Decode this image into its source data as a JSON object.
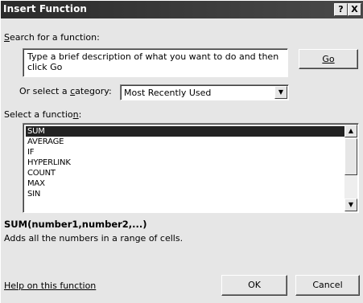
{
  "dialog": {
    "title": "Insert Function",
    "help_button": "?",
    "close_button": "X"
  },
  "search": {
    "label": "Search for a function:",
    "value": "Type a brief description of what you want to do and then click Go",
    "go_button": "Go"
  },
  "category": {
    "label": "Or select a category:",
    "selected": "Most Recently Used"
  },
  "functions": {
    "label": "Select a function:",
    "items": [
      "SUM",
      "AVERAGE",
      "IF",
      "HYPERLINK",
      "COUNT",
      "MAX",
      "SIN"
    ],
    "selected": "SUM"
  },
  "description": {
    "signature": "SUM(number1,number2,...)",
    "text": "Adds all the numbers in a range of cells."
  },
  "footer": {
    "help_link": "Help on this function",
    "ok_button": "OK",
    "cancel_button": "Cancel"
  },
  "icons": {
    "dropdown": "chevron-down-icon",
    "scroll_up": "arrow-up-icon",
    "scroll_down": "arrow-down-icon"
  }
}
